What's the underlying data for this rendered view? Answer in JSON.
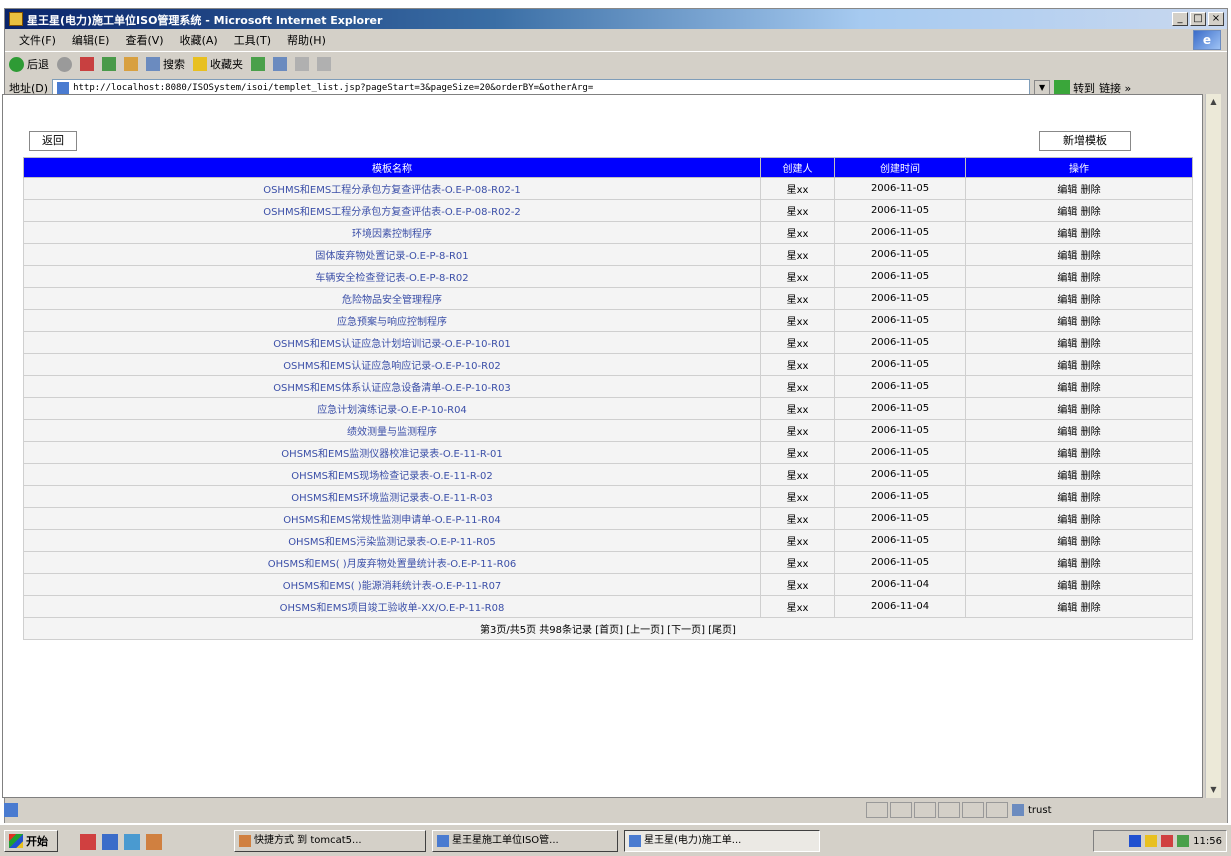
{
  "window": {
    "title": "星王星(电力)施工单位ISO管理系统 - Microsoft Internet Explorer",
    "controls": [
      "_",
      "□",
      "×"
    ]
  },
  "menu": [
    "文件(F)",
    "编辑(E)",
    "查看(V)",
    "收藏(A)",
    "工具(T)",
    "帮助(H)"
  ],
  "toolbar": {
    "back_label": "后退",
    "search_label": "搜索",
    "favorites_label": "收藏夹"
  },
  "address": {
    "label": "地址(D)",
    "url": "http://localhost:8080/ISOSystem/isoi/templet_list.jsp?pageStart=3&pageSize=20&orderBY=&otherArg=",
    "go_label": "转到",
    "links_label": "链接 »"
  },
  "page": {
    "back_button": "返回",
    "new_button": "新增模板",
    "columns": [
      "模板名称",
      "创建人",
      "创建时间",
      "操作"
    ],
    "rows": [
      {
        "name": "OSHMS和EMS工程分承包方复查评估表-O.E-P-08-R02-1",
        "creator": "星xx",
        "date": "2006-11-05",
        "edit": "编辑",
        "del": "删除"
      },
      {
        "name": "OSHMS和EMS工程分承包方复查评估表-O.E-P-08-R02-2",
        "creator": "星xx",
        "date": "2006-11-05",
        "edit": "编辑",
        "del": "删除"
      },
      {
        "name": "环境因素控制程序",
        "creator": "星xx",
        "date": "2006-11-05",
        "edit": "编辑",
        "del": "删除"
      },
      {
        "name": "固体废弃物处置记录-O.E-P-8-R01",
        "creator": "星xx",
        "date": "2006-11-05",
        "edit": "编辑",
        "del": "删除"
      },
      {
        "name": "车辆安全检查登记表-O.E-P-8-R02",
        "creator": "星xx",
        "date": "2006-11-05",
        "edit": "编辑",
        "del": "删除"
      },
      {
        "name": "危险物品安全管理程序",
        "creator": "星xx",
        "date": "2006-11-05",
        "edit": "编辑",
        "del": "删除"
      },
      {
        "name": "应急预案与响应控制程序",
        "creator": "星xx",
        "date": "2006-11-05",
        "edit": "编辑",
        "del": "删除"
      },
      {
        "name": "OSHMS和EMS认证应急计划培训记录-O.E-P-10-R01",
        "creator": "星xx",
        "date": "2006-11-05",
        "edit": "编辑",
        "del": "删除"
      },
      {
        "name": "OSHMS和EMS认证应急响应记录-O.E-P-10-R02",
        "creator": "星xx",
        "date": "2006-11-05",
        "edit": "编辑",
        "del": "删除"
      },
      {
        "name": "OSHMS和EMS体系认证应急设备清单-O.E-P-10-R03",
        "creator": "星xx",
        "date": "2006-11-05",
        "edit": "编辑",
        "del": "删除"
      },
      {
        "name": "应急计划演练记录-O.E-P-10-R04",
        "creator": "星xx",
        "date": "2006-11-05",
        "edit": "编辑",
        "del": "删除"
      },
      {
        "name": "绩效测量与监测程序",
        "creator": "星xx",
        "date": "2006-11-05",
        "edit": "编辑",
        "del": "删除"
      },
      {
        "name": "OHSMS和EMS监测仪器校准记录表-O.E-11-R-01",
        "creator": "星xx",
        "date": "2006-11-05",
        "edit": "编辑",
        "del": "删除"
      },
      {
        "name": "OHSMS和EMS现场检查记录表-O.E-11-R-02",
        "creator": "星xx",
        "date": "2006-11-05",
        "edit": "编辑",
        "del": "删除"
      },
      {
        "name": "OHSMS和EMS环境监测记录表-O.E-11-R-03",
        "creator": "星xx",
        "date": "2006-11-05",
        "edit": "编辑",
        "del": "删除"
      },
      {
        "name": "OHSMS和EMS常规性监测申请单-O.E-P-11-R04",
        "creator": "星xx",
        "date": "2006-11-05",
        "edit": "编辑",
        "del": "删除"
      },
      {
        "name": "OHSMS和EMS污染监测记录表-O.E-P-11-R05",
        "creator": "星xx",
        "date": "2006-11-05",
        "edit": "编辑",
        "del": "删除"
      },
      {
        "name": "OHSMS和EMS( )月废弃物处置量统计表-O.E-P-11-R06",
        "creator": "星xx",
        "date": "2006-11-05",
        "edit": "编辑",
        "del": "删除"
      },
      {
        "name": "OHSMS和EMS( )能源消耗统计表-O.E-P-11-R07",
        "creator": "星xx",
        "date": "2006-11-04",
        "edit": "编辑",
        "del": "删除"
      },
      {
        "name": "OHSMS和EMS项目竣工验收单-XX/O.E-P-11-R08",
        "creator": "星xx",
        "date": "2006-11-04",
        "edit": "编辑",
        "del": "删除"
      }
    ],
    "pagination": "第3页/共5页 共98条记录 [首页] [上一页] [下一页] [尾页]"
  },
  "status": {
    "zone": "trust"
  },
  "taskbar": {
    "start": "开始",
    "tasks": [
      "快捷方式 到 tomcat5...",
      "星王星施工单位ISO管...",
      "星王星(电力)施工单..."
    ],
    "clock": "11:56"
  },
  "colors": {
    "header_bg": "#0000ff",
    "link_text": "#3b4fa8",
    "titlebar_start": "#0a246a"
  }
}
